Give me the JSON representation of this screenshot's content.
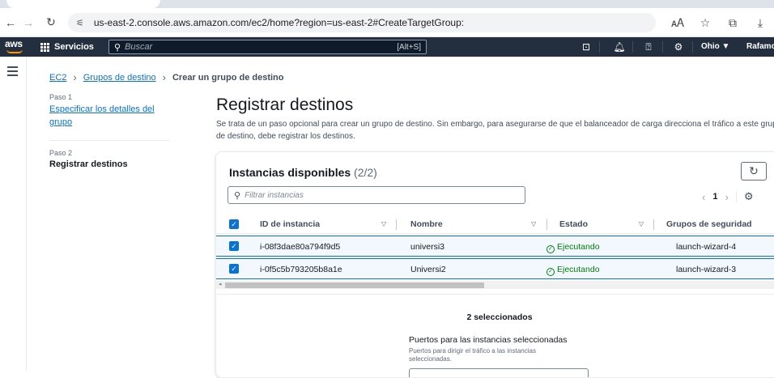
{
  "browser": {
    "url": "us-east-2.console.aws.amazon.com/ec2/home?region=us-east-2#CreateTargetGroup:"
  },
  "aws_nav": {
    "logo": "aws",
    "services_label": "Servicios",
    "search_placeholder": "Buscar",
    "search_shortcut": "[Alt+S]",
    "region": "Ohio ▼",
    "user": "Rafamor"
  },
  "breadcrumb": {
    "items": [
      "EC2",
      "Grupos de destino"
    ],
    "current": "Crear un grupo de destino"
  },
  "steps": {
    "step1_label": "Paso 1",
    "step1_title": "Especificar los detalles del grupo",
    "step2_label": "Paso 2",
    "step2_title": "Registrar destinos"
  },
  "main": {
    "title": "Registrar destinos",
    "description": "Se trata de un paso opcional para crear un grupo de destino. Sin embargo, para asegurarse de que el balanceador de carga direcciona el tráfico a este grupo de destino, debe registrar los destinos."
  },
  "table": {
    "title": "Instancias disponibles",
    "count": "(2/2)",
    "filter_placeholder": "Filtrar instancias",
    "page": "1",
    "columns": [
      "ID de instancia",
      "Nombre",
      "Estado",
      "Grupos de seguridad"
    ],
    "rows": [
      {
        "id": "i-08f3dae80a794f9d5",
        "name": "universi3",
        "state": "Ejecutando",
        "sg": "launch-wizard-4"
      },
      {
        "id": "i-0f5c5b793205b8a1e",
        "name": "Universi2",
        "state": "Ejecutando",
        "sg": "launch-wizard-3"
      }
    ]
  },
  "selection": {
    "count_text": "2 seleccionados",
    "ports_label": "Puertos para las instancias seleccionadas",
    "ports_description": "Puertos para dirigir el tráfico a las instancias seleccionadas."
  }
}
